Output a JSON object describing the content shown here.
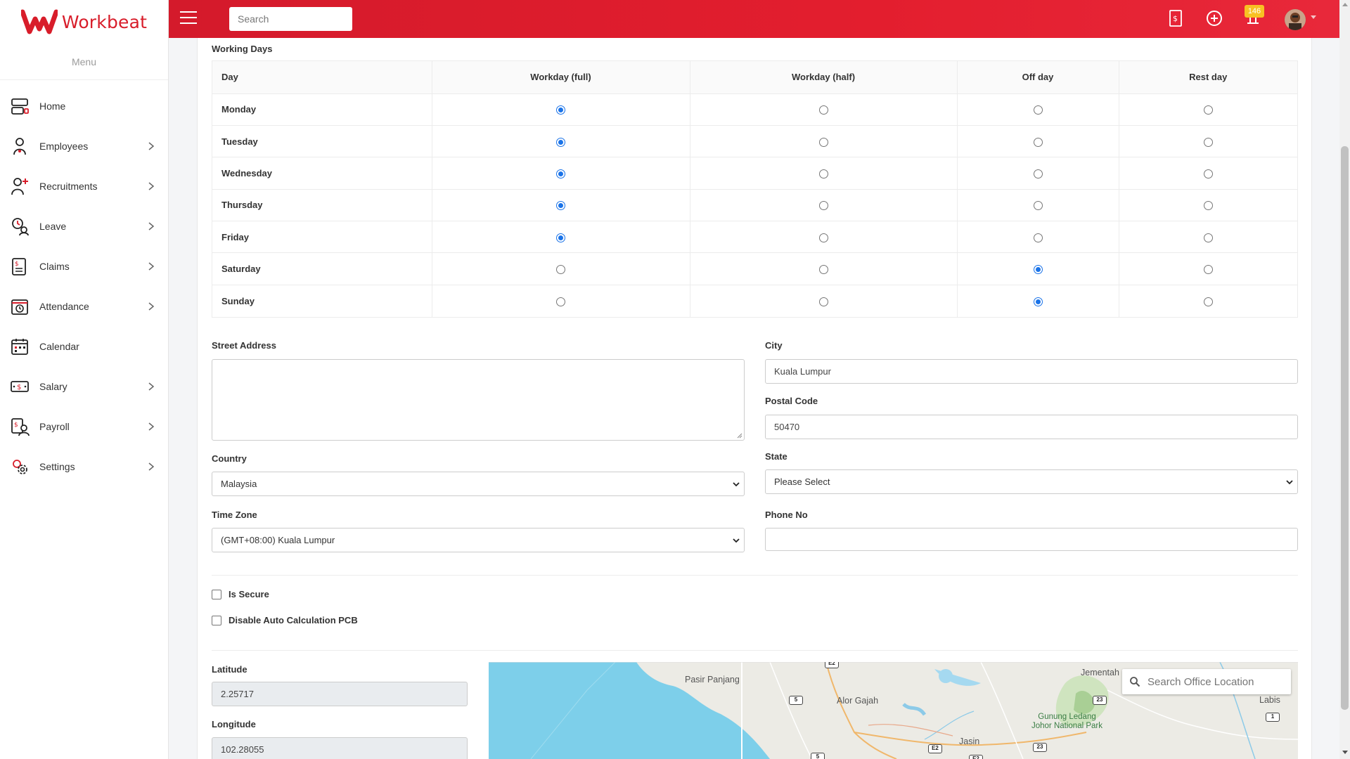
{
  "brand": {
    "name": "Workbeat",
    "color": "#d81d2a"
  },
  "sidebar": {
    "menu_title": "Menu",
    "items": [
      {
        "label": "Home",
        "icon": "home-icon",
        "has_submenu": false
      },
      {
        "label": "Employees",
        "icon": "employees-icon",
        "has_submenu": true
      },
      {
        "label": "Recruitments",
        "icon": "recruitments-icon",
        "has_submenu": true
      },
      {
        "label": "Leave",
        "icon": "leave-icon",
        "has_submenu": true
      },
      {
        "label": "Claims",
        "icon": "claims-icon",
        "has_submenu": true
      },
      {
        "label": "Attendance",
        "icon": "attendance-icon",
        "has_submenu": true
      },
      {
        "label": "Calendar",
        "icon": "calendar-icon",
        "has_submenu": false
      },
      {
        "label": "Salary",
        "icon": "salary-icon",
        "has_submenu": true
      },
      {
        "label": "Payroll",
        "icon": "payroll-icon",
        "has_submenu": true
      },
      {
        "label": "Settings",
        "icon": "settings-icon",
        "has_submenu": true
      }
    ]
  },
  "topbar": {
    "search_placeholder": "Search",
    "notification_count": "146",
    "icons": [
      "claims-icon",
      "add-circle-icon",
      "notification-icon",
      "avatar"
    ]
  },
  "working_days": {
    "title": "Working Days",
    "columns": [
      "Day",
      "Workday (full)",
      "Workday (half)",
      "Off day",
      "Rest day"
    ],
    "rows": [
      {
        "day": "Monday",
        "selected": "Workday (full)"
      },
      {
        "day": "Tuesday",
        "selected": "Workday (full)"
      },
      {
        "day": "Wednesday",
        "selected": "Workday (full)"
      },
      {
        "day": "Thursday",
        "selected": "Workday (full)"
      },
      {
        "day": "Friday",
        "selected": "Workday (full)"
      },
      {
        "day": "Saturday",
        "selected": "Off day"
      },
      {
        "day": "Sunday",
        "selected": "Off day"
      }
    ]
  },
  "form": {
    "street_address": {
      "label": "Street Address",
      "value": ""
    },
    "city": {
      "label": "City",
      "value": "Kuala Lumpur"
    },
    "postal_code": {
      "label": "Postal Code",
      "value": "50470"
    },
    "country": {
      "label": "Country",
      "value": "Malaysia"
    },
    "state": {
      "label": "State",
      "value": "Please Select"
    },
    "time_zone": {
      "label": "Time Zone",
      "value": "(GMT+08:00) Kuala Lumpur"
    },
    "phone_no": {
      "label": "Phone No",
      "value": ""
    },
    "is_secure": {
      "label": "Is Secure",
      "checked": false
    },
    "disable_pcb": {
      "label": "Disable Auto Calculation PCB",
      "checked": false
    },
    "latitude": {
      "label": "Latitude",
      "value": "2.25717"
    },
    "longitude": {
      "label": "Longitude",
      "value": "102.28055"
    }
  },
  "map": {
    "search_placeholder": "Search Office Location",
    "places": [
      "Pasir Panjang",
      "Alor Gajah",
      "Jasin",
      "Jementah",
      "Labis",
      "Gunung Ledang Johor National Park"
    ],
    "park_name_line1": "Gunung Ledang",
    "park_name_line2": "Johor National Park",
    "route_shields": [
      "E2",
      "5",
      "23",
      "1",
      "E2",
      "5",
      "23",
      "E2"
    ]
  },
  "colors": {
    "accent": "#e31e2e",
    "radio_selected": "#1a73e8",
    "badge": "#f8c123",
    "map_water": "#7dcfea"
  }
}
